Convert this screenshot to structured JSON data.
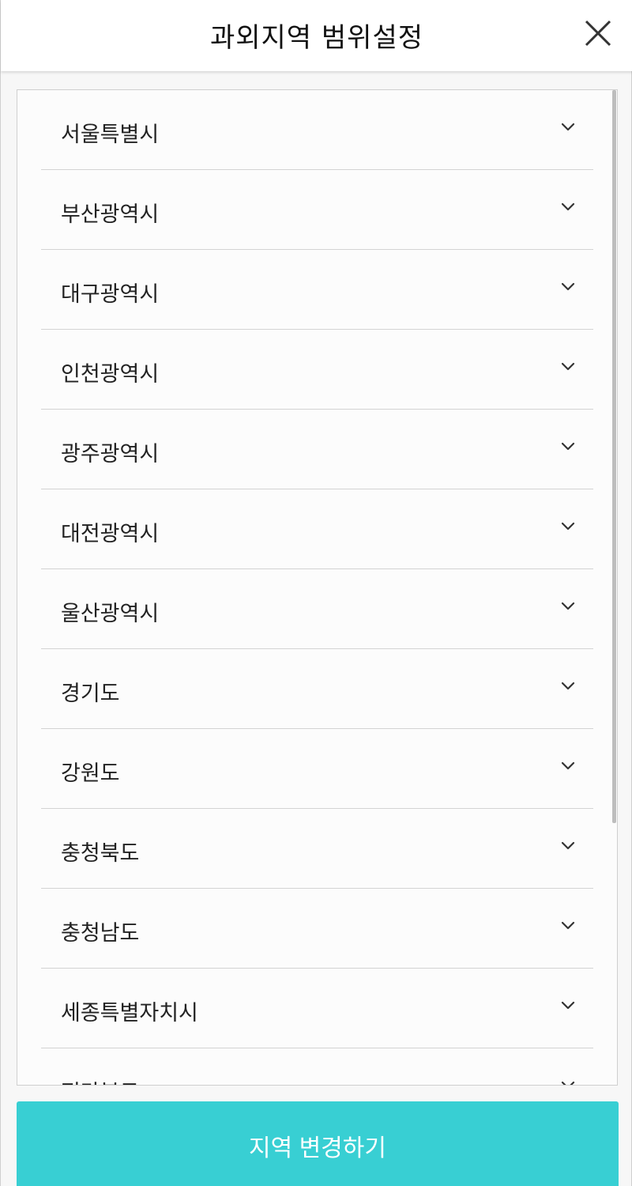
{
  "header": {
    "title": "과외지역 범위설정",
    "close_icon": "close-icon"
  },
  "regions": [
    {
      "label": "서울특별시"
    },
    {
      "label": "부산광역시"
    },
    {
      "label": "대구광역시"
    },
    {
      "label": "인천광역시"
    },
    {
      "label": "광주광역시"
    },
    {
      "label": "대전광역시"
    },
    {
      "label": "울산광역시"
    },
    {
      "label": "경기도"
    },
    {
      "label": "강원도"
    },
    {
      "label": "충청북도"
    },
    {
      "label": "충청남도"
    },
    {
      "label": "세종특별자치시"
    },
    {
      "label": "전라북도"
    }
  ],
  "chevron_icon": "chevron-down-icon",
  "footer": {
    "button_label": "지역 변경하기"
  },
  "colors": {
    "accent": "#38cfd3",
    "divider": "#d3d3d3",
    "text": "#222222"
  }
}
